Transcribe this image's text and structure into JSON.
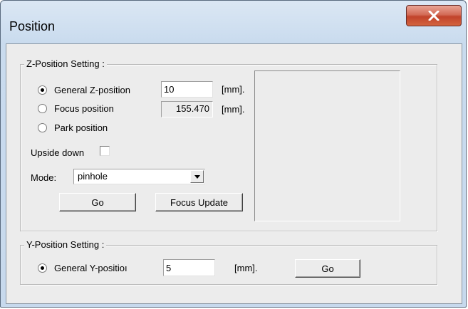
{
  "window": {
    "title": "Position",
    "close_icon": "close-x-icon"
  },
  "z_group": {
    "label": "Z-Position Setting :",
    "options": [
      {
        "label": "General Z-position",
        "selected": true
      },
      {
        "label": "Focus position",
        "selected": false
      },
      {
        "label": "Park position",
        "selected": false
      }
    ],
    "general_z_value": "10",
    "general_z_unit": "[mm].",
    "focus_value": "155.470",
    "focus_unit": "[mm].",
    "upside_down_label": "Upside down",
    "upside_down_checked": false,
    "mode_label": "Mode:",
    "mode_value": "pinhole",
    "go_label": "Go",
    "focus_update_label": "Focus Update"
  },
  "y_group": {
    "label": "Y-Position Setting :",
    "option_label": "General Y-positioı",
    "option_selected": true,
    "value": "5",
    "unit": "[mm].",
    "go_label": "Go"
  }
}
